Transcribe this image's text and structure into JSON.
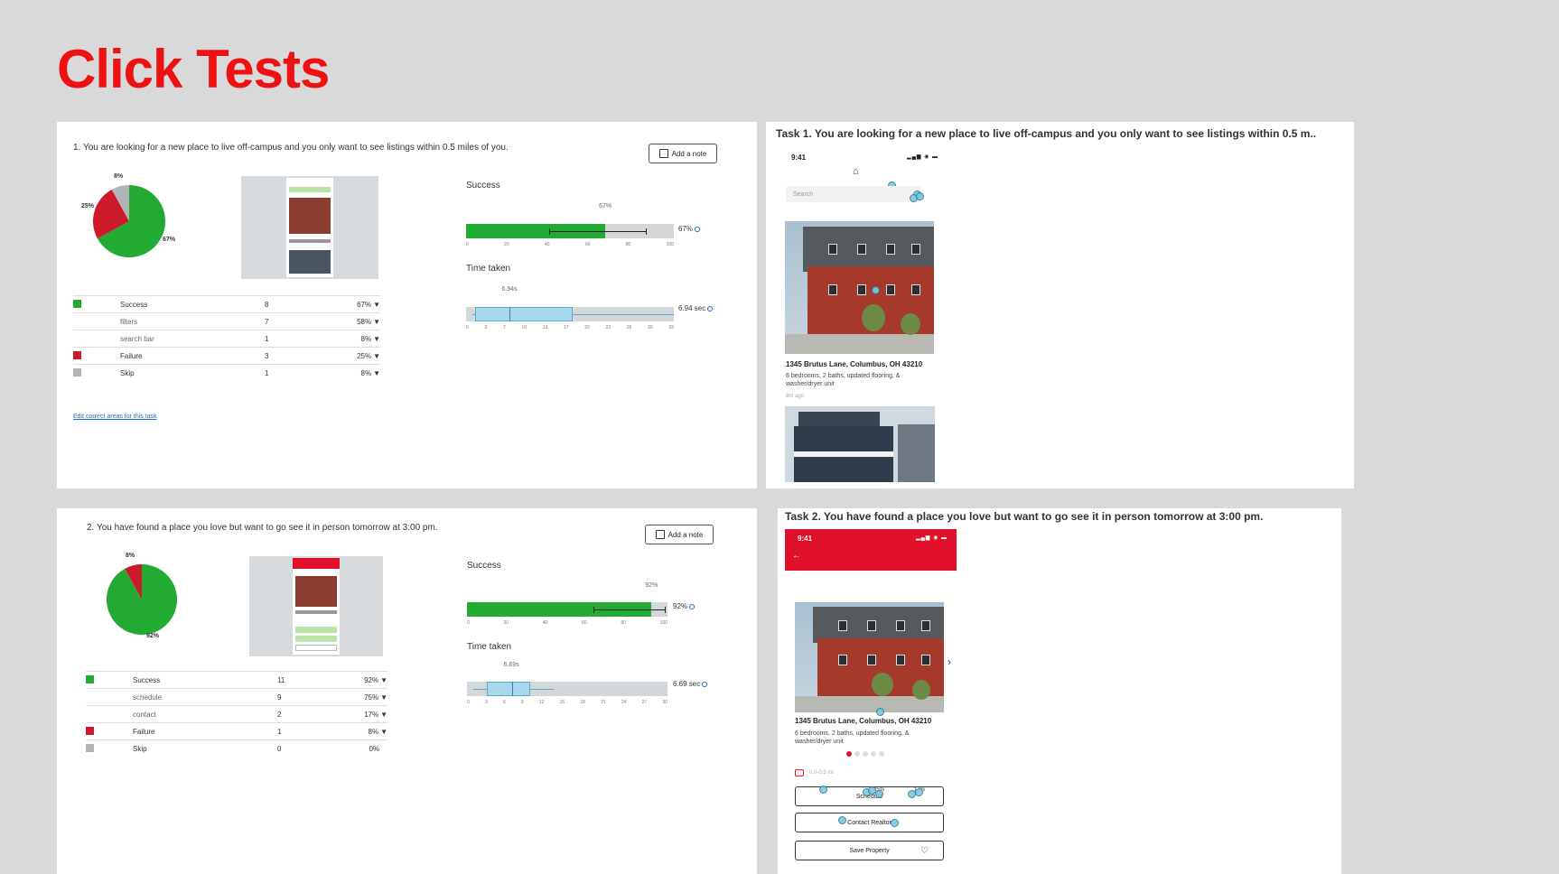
{
  "page": {
    "title": "Click Tests"
  },
  "colors": {
    "title_red": "#ee1111",
    "success": "#22aa33",
    "failure": "#cc1a2a",
    "skip": "#b0b4b8",
    "box": "#a8d8ee",
    "brand_red": "#e0102a"
  },
  "task1_results": {
    "question": "1. You are looking for a new place to live off-campus and you only want to see listings within 0.5 miles of you.",
    "add_note": "Add a note",
    "pie": {
      "segments": [
        {
          "name": "Success",
          "value": 67,
          "color": "#22aa33"
        },
        {
          "name": "Failure",
          "value": 25,
          "color": "#cc1a2a"
        },
        {
          "name": "Skip",
          "value": 8,
          "color": "#b0b4b8"
        }
      ],
      "labels": {
        "success": "67%",
        "failure": "25%",
        "skip": "8%"
      }
    },
    "success_chart": {
      "label": "Success",
      "value_pct": 67,
      "top_label": "67%",
      "right_label": "67%",
      "ci": [
        40,
        87
      ],
      "ticks": [
        "0",
        "20",
        "40",
        "60",
        "80",
        "100"
      ]
    },
    "time_chart": {
      "label": "Time taken",
      "median_label": "6.94s",
      "right_label": "6.94 sec",
      "range": [
        0,
        33
      ],
      "box": {
        "whisker_low": 1,
        "q1": 1.5,
        "median": 6.94,
        "q3": 17,
        "whisker_high": 33
      },
      "ticks": [
        "0",
        "3",
        "7",
        "10",
        "13",
        "17",
        "20",
        "23",
        "26",
        "30",
        "33"
      ]
    },
    "table": [
      {
        "swatch": "#22aa33",
        "name": "Success",
        "count": "8",
        "pct": "67%",
        "sub": false
      },
      {
        "swatch": "",
        "name": "filters",
        "count": "7",
        "pct": "58%",
        "sub": true
      },
      {
        "swatch": "",
        "name": "search bar",
        "count": "1",
        "pct": "8%",
        "sub": true
      },
      {
        "swatch": "#cc1a2a",
        "name": "Failure",
        "count": "3",
        "pct": "25%",
        "sub": false
      },
      {
        "swatch": "#b0b4b8",
        "name": "Skip",
        "count": "1",
        "pct": "8%",
        "sub": false
      }
    ],
    "edit_link": "Edit correct areas for this task"
  },
  "task1_heatmap": {
    "heading": "Task 1. You are looking for a new place to live off-campus and you only want to see listings within 0.5 m..",
    "time": "9:41",
    "status_icons": "▂▄▆ ◉ ▬",
    "search_placeholder": "Search",
    "address": "1345 Brutus Lane, Columbus, OH 43210",
    "description": "6 bedrooms, 2 baths, updated flooring, & washer/dryer unit",
    "ago": "8m ago"
  },
  "task2_results": {
    "question": "2. You have found a place you love but want to go see it in person tomorrow at 3:00 pm.",
    "add_note": "Add a note",
    "pie": {
      "segments": [
        {
          "name": "Success",
          "value": 92,
          "color": "#22aa33"
        },
        {
          "name": "Failure",
          "value": 8,
          "color": "#cc1a2a"
        }
      ],
      "labels": {
        "success": "92%",
        "failure": "8%"
      }
    },
    "success_chart": {
      "label": "Success",
      "value_pct": 92,
      "top_label": "92%",
      "right_label": "92%",
      "ci": [
        63,
        99
      ],
      "ticks": [
        "0",
        "20",
        "40",
        "60",
        "80",
        "100"
      ]
    },
    "time_chart": {
      "label": "Time taken",
      "median_label": "6.69s",
      "right_label": "6.69 sec",
      "range": [
        0,
        30
      ],
      "box": {
        "whisker_low": 1,
        "q1": 3,
        "median": 6.69,
        "q3": 9.5,
        "whisker_high": 13
      },
      "ticks": [
        "0",
        "3",
        "6",
        "9",
        "12",
        "15",
        "18",
        "21",
        "24",
        "27",
        "30"
      ]
    },
    "table": [
      {
        "swatch": "#22aa33",
        "name": "Success",
        "count": "11",
        "pct": "92%",
        "sub": false
      },
      {
        "swatch": "",
        "name": "schedule",
        "count": "9",
        "pct": "75%",
        "sub": true
      },
      {
        "swatch": "",
        "name": "contact",
        "count": "2",
        "pct": "17%",
        "sub": true
      },
      {
        "swatch": "#cc1a2a",
        "name": "Failure",
        "count": "1",
        "pct": "8%",
        "sub": false
      },
      {
        "swatch": "#b0b4b8",
        "name": "Skip",
        "count": "0",
        "pct": "0%",
        "sub": false
      }
    ]
  },
  "task2_heatmap": {
    "heading": "Task 2. You have found a place you love but want to go see it in person tomorrow at 3:00 pm.",
    "time": "9:41",
    "status_icons": "▂▄▆ ◉ ▬",
    "back": "←",
    "address": "1345 Brutus Lane, Columbus, OH 43210",
    "description": "6 bedrooms, 2 baths, updated flooring, & washer/dryer unit",
    "distance": "0.0-0.5 mi",
    "schedule_pct_a": "75%",
    "schedule_pct_b": "17%",
    "buttons": {
      "schedule": "Schedule",
      "contact": "Contact Realtor",
      "save": "Save Property"
    }
  }
}
